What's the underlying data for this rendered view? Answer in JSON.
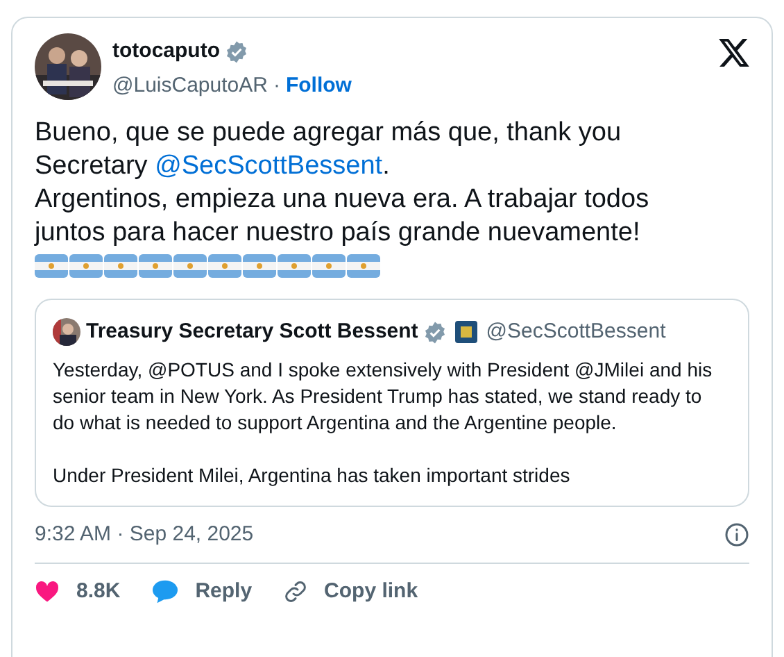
{
  "author": {
    "name": "totocaputo",
    "handle": "@LuisCaputoAR",
    "separator": "·",
    "follow": "Follow",
    "verified": true
  },
  "body": {
    "line_1": "Bueno, que se puede agregar más que, thank you Secretary ",
    "mention": "@SecScottBessent",
    "line_1_end": ".",
    "line_2": "Argentinos, empieza una nueva era. A trabajar todos juntos para hacer nuestro país grande nuevamente!"
  },
  "flags": [
    {
      "kind": "argentina"
    },
    {
      "kind": "argentina"
    },
    {
      "kind": "argentina"
    },
    {
      "kind": "argentina"
    },
    {
      "kind": "argentina"
    },
    {
      "kind": "argentina"
    },
    {
      "kind": "argentina"
    },
    {
      "kind": "argentina"
    },
    {
      "kind": "argentina"
    },
    {
      "kind": "argentina"
    }
  ],
  "quote": {
    "name": "Treasury Secretary Scott Bessent",
    "verified": true,
    "handle": "@SecScottBessent",
    "paragraphs": [
      "Yesterday, @POTUS and I spoke extensively with President @JMilei and his senior team in New York.  As President Trump has stated, we stand ready to do what is needed to support Argentina and the Argentine people.",
      "Under President Milei, Argentina has taken important strides"
    ]
  },
  "timestamp": "9:32 AM · Sep 24, 2025",
  "actions": [
    {
      "kind": "like",
      "label": "8.8K"
    },
    {
      "kind": "reply",
      "label": "Reply"
    },
    {
      "kind": "copy",
      "label": "Copy link"
    }
  ]
}
